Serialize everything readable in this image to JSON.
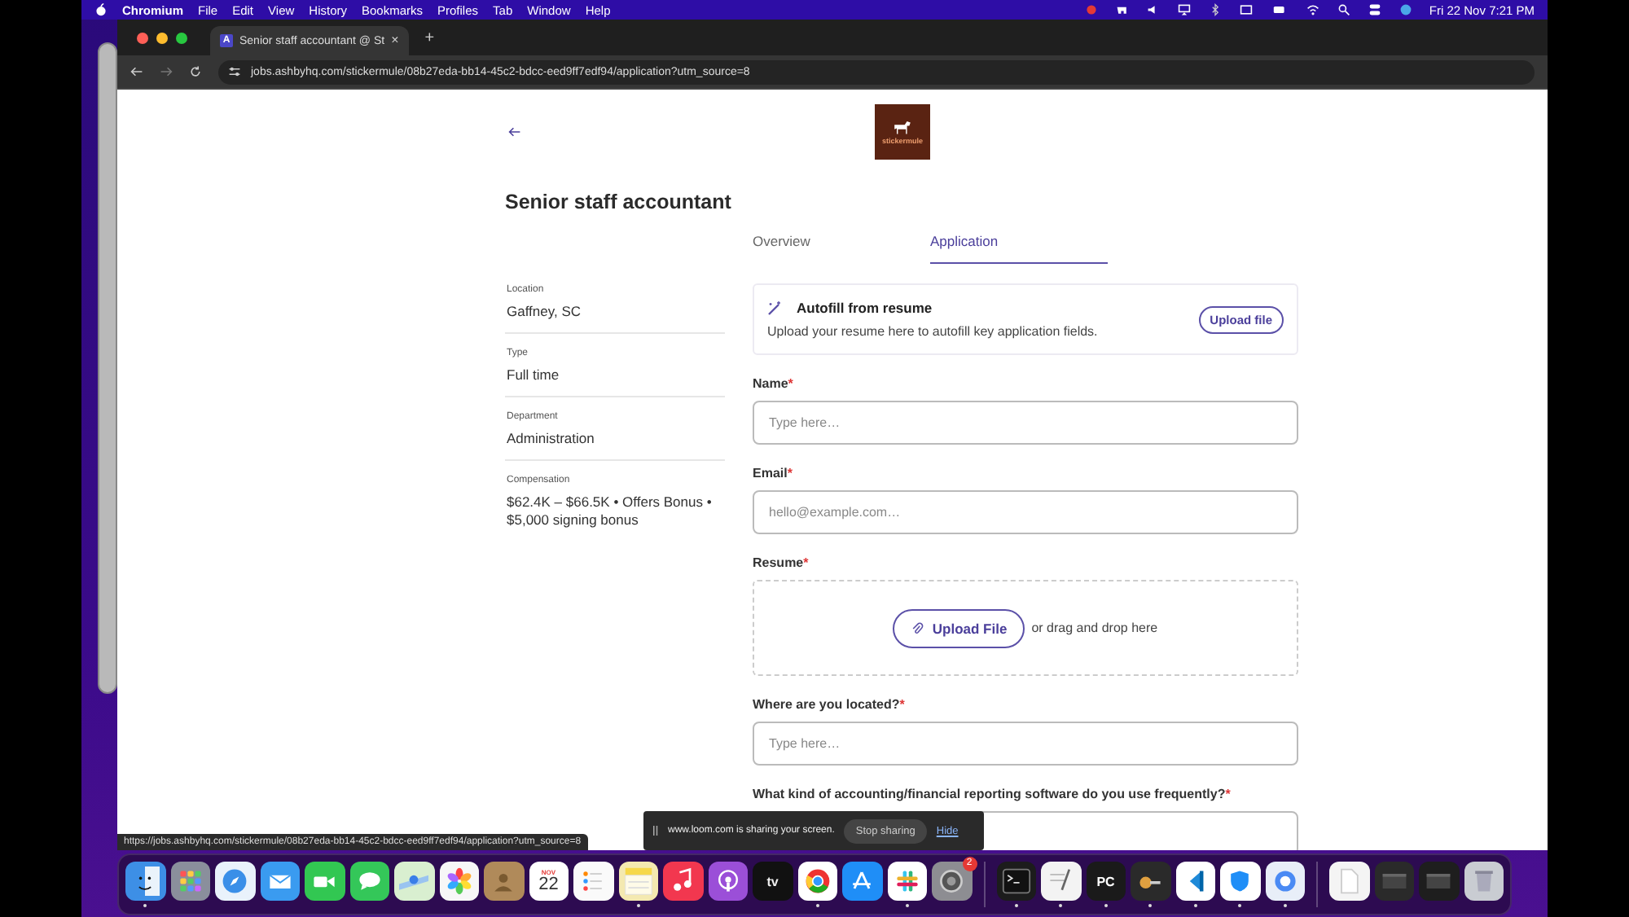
{
  "menubar": {
    "app": "Chromium",
    "menus": [
      "File",
      "Edit",
      "View",
      "History",
      "Bookmarks",
      "Profiles",
      "Tab",
      "Window",
      "Help"
    ],
    "clock": "Fri 22 Nov  7:21 PM"
  },
  "browser": {
    "tabs": [
      {
        "favicon": "A",
        "title": "Senior staff accountant @ St",
        "close": "×",
        "selected": true
      }
    ],
    "new_tab": "+",
    "url": "jobs.ashbyhq.com/stickermule/08b27eda-bb14-45c2-bdcc-eed9ff7edf94/application?utm_source=8"
  },
  "page": {
    "logo": "stickermule",
    "title": "Senior staff accountant",
    "tabs": [
      {
        "label": "Overview",
        "selected": false
      },
      {
        "label": "Application",
        "selected": true
      }
    ],
    "details": [
      {
        "label": "Location",
        "value": "Gaffney, SC"
      },
      {
        "label": "Type",
        "value": "Full time"
      },
      {
        "label": "Department",
        "value": "Administration"
      },
      {
        "label": "Compensation",
        "value": "$62.4K – $66.5K • Offers Bonus • $5,000 signing bonus"
      }
    ],
    "autofill": {
      "title": "Autofill from resume",
      "text": "Upload your resume here to autofill key application fields.",
      "button": "Upload file"
    },
    "fields": [
      {
        "kind": "input",
        "label": "Name",
        "mark": "*",
        "placeholder": "Type here…"
      },
      {
        "kind": "input",
        "label": "Email",
        "mark": "*",
        "placeholder": "hello@example.com…"
      },
      {
        "kind": "upload",
        "label": "Resume",
        "mark": "*",
        "button": "Upload File",
        "hint": "or drag and drop here"
      },
      {
        "kind": "input",
        "label": "Where are you located?",
        "mark": "*",
        "placeholder": "Type here…"
      },
      {
        "kind": "input",
        "label": "What kind of accounting/financial reporting software do you use frequently?",
        "mark": "*"
      }
    ]
  },
  "status_url": "https://jobs.ashbyhq.com/stickermule/08b27eda-bb14-45c2-bdcc-eed9ff7edf94/application?utm_source=8",
  "sharing_bar": {
    "text": "www.loom.com is sharing your screen.",
    "stop": "Stop sharing",
    "hide": "Hide"
  },
  "dock": {
    "items": [
      {
        "kind": "face",
        "color": "#3d8fe6",
        "running": true
      },
      {
        "kind": "grid",
        "color": "#8a8f9c",
        "running": false
      },
      {
        "kind": "compass",
        "color": "#e9f2fb",
        "running": false
      },
      {
        "kind": "envelope",
        "color": "#3a9bf0",
        "running": false
      },
      {
        "kind": "camera",
        "color": "#32c752",
        "running": false
      },
      {
        "kind": "bubble",
        "color": "#34c759",
        "running": false
      },
      {
        "kind": "map",
        "color": "#d9efd0",
        "running": false
      },
      {
        "kind": "flower",
        "color": "#f7f7f7",
        "running": false
      },
      {
        "kind": "person",
        "color": "#b08a5a",
        "running": false
      },
      {
        "kind": "calendar",
        "color": "#ffffff",
        "running": false,
        "month": "NOV",
        "day": "22"
      },
      {
        "kind": "list",
        "color": "#fafafa",
        "running": false
      },
      {
        "kind": "notepad",
        "color": "#f4e9b0",
        "running": true
      },
      {
        "kind": "note",
        "color": "#f2374f",
        "running": false
      },
      {
        "kind": "podcast",
        "color": "#9b4fd8",
        "running": false
      },
      {
        "kind": "tv",
        "color": "#111111",
        "running": false,
        "text": "tv"
      },
      {
        "kind": "globe",
        "color": "#ffffff",
        "running": true
      },
      {
        "kind": "letter",
        "color": "#1f8ef7",
        "running": false
      },
      {
        "kind": "hash",
        "color": "#ffffff",
        "running": true
      },
      {
        "kind": "gear",
        "color": "#8d8d92",
        "running": false,
        "badge": "2"
      },
      {
        "kind": "separator"
      },
      {
        "kind": "terminal",
        "color": "#1c1c1c",
        "running": true
      },
      {
        "kind": "pen",
        "color": "#f3f3f3",
        "running": true
      },
      {
        "kind": "pc",
        "color": "#1a1a1a",
        "running": true,
        "text": "PC"
      },
      {
        "kind": "key",
        "color": "#2a2a2a",
        "running": true
      },
      {
        "kind": "code",
        "color": "#ffffff",
        "running": true
      },
      {
        "kind": "shield",
        "color": "#ffffff",
        "running": true
      },
      {
        "kind": "circle",
        "color": "#e8eef8",
        "running": true
      },
      {
        "kind": "separator"
      },
      {
        "kind": "document",
        "color": "#f4f4f4",
        "running": false
      },
      {
        "kind": "window",
        "color": "#2a2a2a",
        "running": false
      },
      {
        "kind": "window",
        "color": "#1e1e1e",
        "running": false
      },
      {
        "kind": "trash",
        "color": "#c9ccd2",
        "running": false
      }
    ]
  }
}
